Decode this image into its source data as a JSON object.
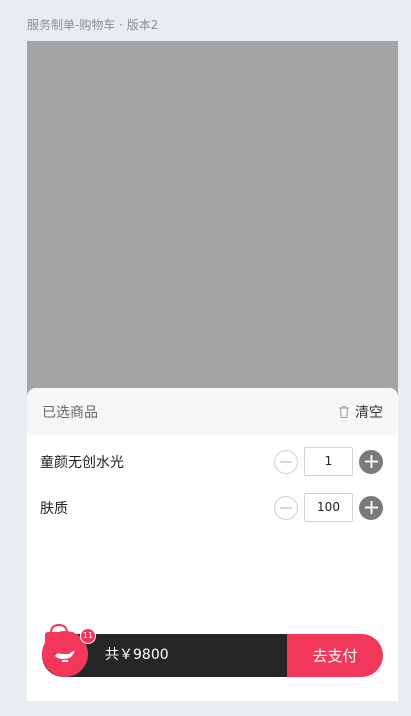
{
  "page_caption": "服务制单-购物车 · 版本2",
  "cart_sheet": {
    "title": "已选商品",
    "clear_label": "清空"
  },
  "items": [
    {
      "name": "童颜无创水光",
      "quantity": "1"
    },
    {
      "name": "肤质",
      "quantity": "100"
    }
  ],
  "checkout": {
    "badge_count": "11",
    "total_text": "共￥9800",
    "pay_label": "去支付"
  },
  "colors": {
    "accent": "#f2385a",
    "bar_dark": "#262626",
    "overlay": "#a4a4a4"
  }
}
